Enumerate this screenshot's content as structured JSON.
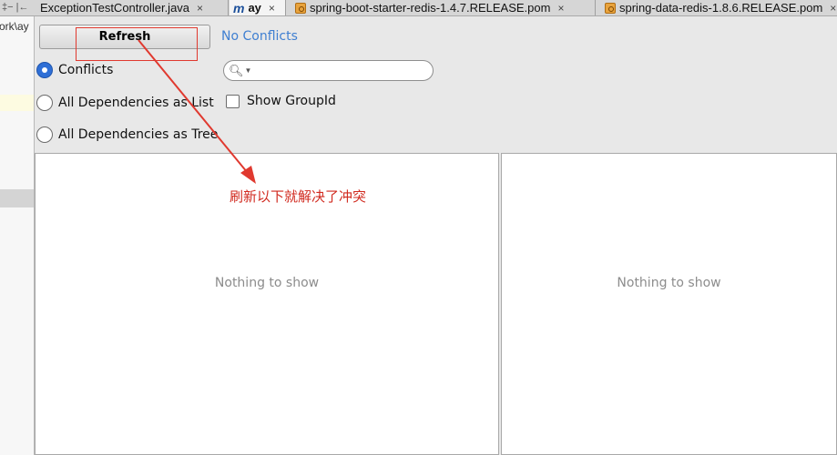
{
  "tabs": {
    "left_glyphs": "‡− |←",
    "items": [
      {
        "label": "ExceptionTestController.java",
        "close": "×",
        "icon": "none"
      },
      {
        "label": "ay",
        "close": "×",
        "icon": "maven-m-icon",
        "icon_glyph": "m"
      },
      {
        "label": "spring-boot-starter-redis-1.4.7.RELEASE.pom",
        "close": "×",
        "icon": "pom-icon"
      },
      {
        "label": "spring-data-redis-1.8.6.RELEASE.pom",
        "close": "×",
        "icon": "pom-icon"
      }
    ]
  },
  "left_strip": {
    "path_fragment": "ork\\ay"
  },
  "toolbar": {
    "refresh_label": "Refresh",
    "status_text": "No Conflicts",
    "status_color": "#3f7fd1"
  },
  "view_mode": {
    "options": [
      {
        "label": "Conflicts",
        "checked": true
      },
      {
        "label": "All Dependencies as List",
        "checked": false
      },
      {
        "label": "All Dependencies as Tree",
        "checked": false
      }
    ]
  },
  "search": {
    "value": "",
    "placeholder": "",
    "icon": "search-icon"
  },
  "show_group_id": {
    "label": "Show GroupId",
    "checked": false
  },
  "panels": {
    "left_empty_text": "Nothing to show",
    "right_empty_text": "Nothing to show"
  },
  "annotation": {
    "text": "刷新以下就解决了冲突",
    "color": "#d12a1f"
  }
}
